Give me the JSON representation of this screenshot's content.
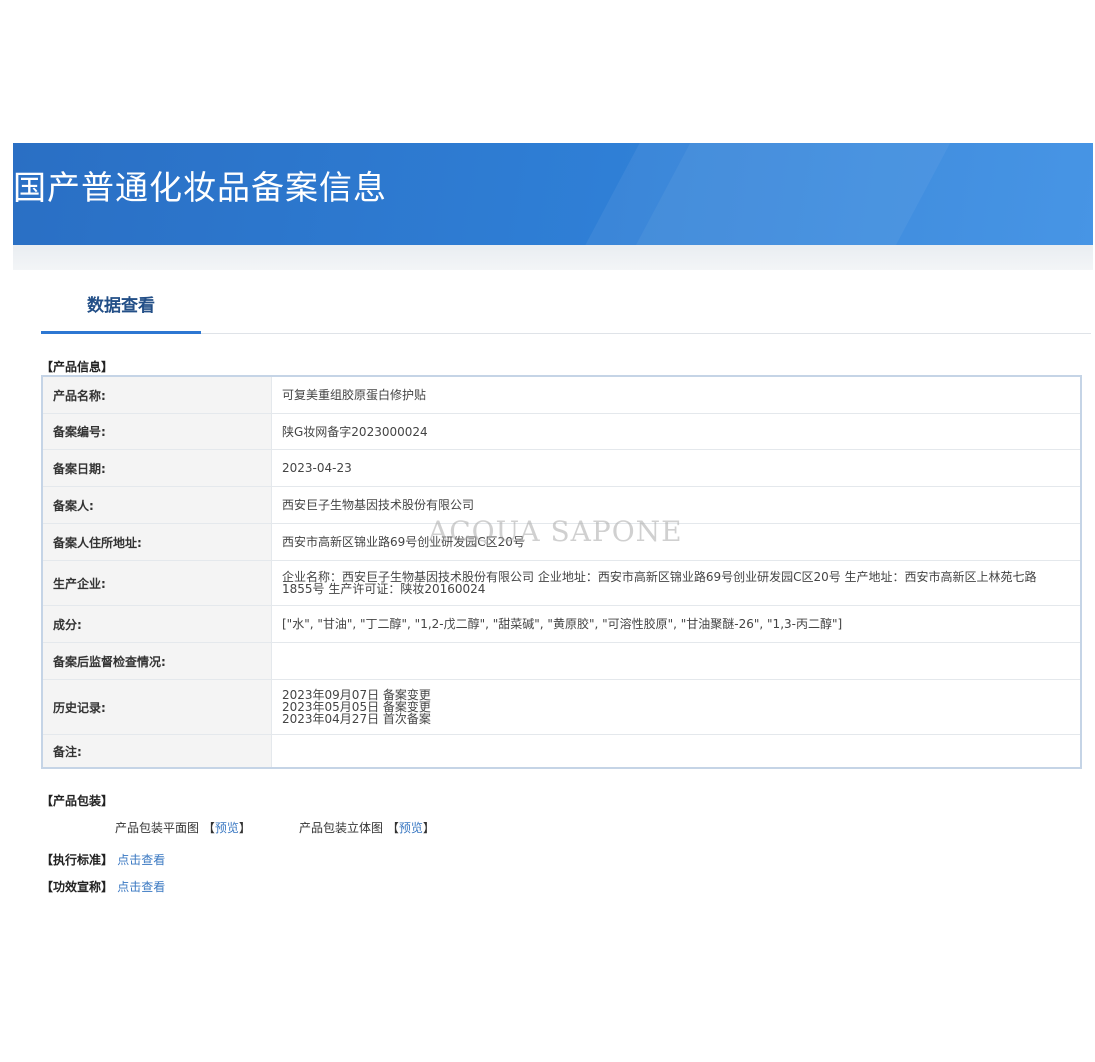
{
  "header": {
    "title": "国产普通化妆品备案信息"
  },
  "tabs": [
    {
      "label": "数据查看",
      "active": true
    }
  ],
  "product_info": {
    "section_label": "【产品信息】",
    "rows": [
      {
        "label": "产品名称:",
        "value": "可复美重组胶原蛋白修护贴"
      },
      {
        "label": "备案编号:",
        "value": "陕G妆网备字2023000024"
      },
      {
        "label": "备案日期:",
        "value": "2023-04-23"
      },
      {
        "label": "备案人:",
        "value": "西安巨子生物基因技术股份有限公司"
      },
      {
        "label": "备案人住所地址:",
        "value": "西安市高新区锦业路69号创业研发园C区20号"
      },
      {
        "label": "生产企业:",
        "value": "企业名称：西安巨子生物基因技术股份有限公司 企业地址：西安市高新区锦业路69号创业研发园C区20号 生产地址：西安市高新区上林苑七路1855号 生产许可证：陕妆20160024"
      },
      {
        "label": "成分:",
        "value": "[\"水\", \"甘油\", \"丁二醇\", \"1,2-戊二醇\", \"甜菜碱\", \"黄原胶\", \"可溶性胶原\", \"甘油聚醚-26\", \"1,3-丙二醇\"]"
      },
      {
        "label": "备案后监督检查情况:",
        "value": ""
      },
      {
        "label": "历史记录:",
        "value": "2023年09月07日 备案变更\n2023年05月05日 备案变更\n2023年04月27日 首次备案"
      },
      {
        "label": "备注:",
        "value": ""
      }
    ]
  },
  "watermark": "ACQUA SAPONE",
  "packaging": {
    "section_label": "【产品包装】",
    "flat_label": "产品包装平面图",
    "flat_preview": "预览",
    "solid_label": "产品包装立体图",
    "solid_preview": "预览",
    "bracket_open": "【",
    "bracket_close": "】"
  },
  "standard": {
    "section_label": "【执行标准】",
    "link": "点击查看"
  },
  "efficacy": {
    "section_label": "【功效宣称】",
    "link": "点击查看"
  }
}
